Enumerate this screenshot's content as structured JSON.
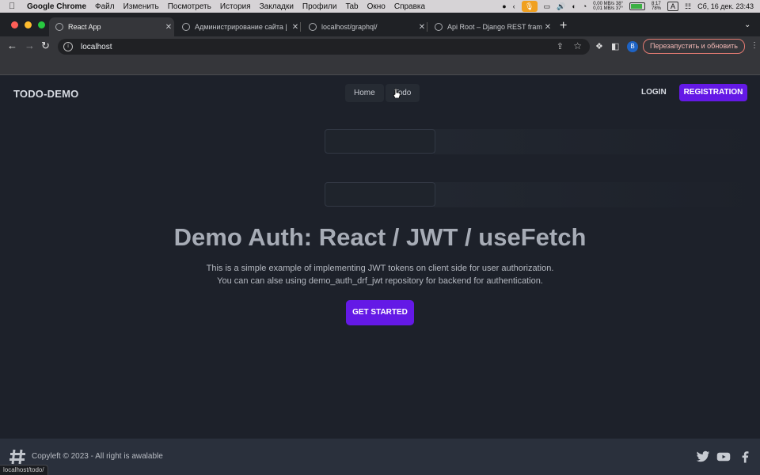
{
  "menubar": {
    "app": "Google Chrome",
    "items": [
      "Файл",
      "Изменить",
      "Посмотреть",
      "История",
      "Закладки",
      "Профили",
      "Tab",
      "Окно",
      "Справка"
    ],
    "net_up": "0,00 MB/s",
    "net_down": "0,01 MB/s",
    "temp1": "38°",
    "temp2": "37°",
    "battery_time": "8:17",
    "battery_pct": "78%",
    "input_lang": "A",
    "datetime": "Сб, 16 дек.  23:43"
  },
  "tabs": [
    {
      "title": "React App",
      "active": true
    },
    {
      "title": "Администрирование сайта |",
      "active": false
    },
    {
      "title": "localhost/graphql/",
      "active": false
    },
    {
      "title": "Api Root – Django REST framew",
      "active": false
    }
  ],
  "toolbar": {
    "url": "localhost",
    "profile_initial": "B",
    "relaunch_label": "Перезапустить и обновить"
  },
  "nav": {
    "brand": "TODO-DEMO",
    "links": [
      "Home",
      "Todo"
    ],
    "login": "LOGIN",
    "registration": "REGISTRATION"
  },
  "hero": {
    "title": "Demo Auth: React / JWT / useFetch",
    "line1": "This is a simple example of implementing JWT tokens on client side for user authorization.",
    "line2": "You can can alse using demo_auth_drf_jwt repository for backend for authentication.",
    "cta": "GET STARTED"
  },
  "footer": {
    "copyright": "Copyleft © 2023 - All right is awalable",
    "social": [
      "twitter-icon",
      "youtube-icon",
      "facebook-icon"
    ]
  },
  "status_url": "localhost/todo/",
  "colors": {
    "accent": "#6419e6",
    "page_bg": "#1d212a",
    "footer_bg": "#2a303c"
  }
}
